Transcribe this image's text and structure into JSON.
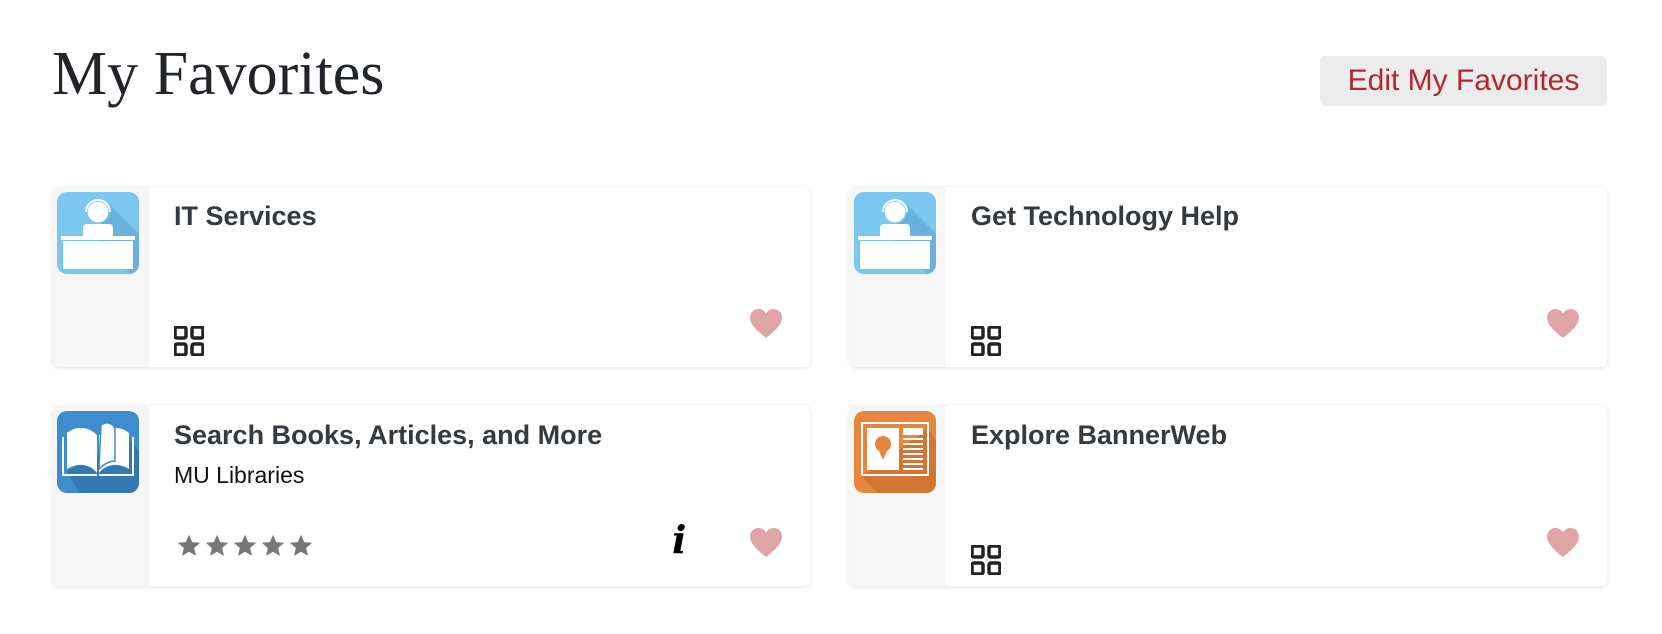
{
  "header": {
    "title": "My Favorites",
    "edit_button_label": "Edit My Favorites"
  },
  "colors": {
    "accent": "#b5272f",
    "heart": "#e0a3a6",
    "title_text": "#343a40",
    "star": "#777777"
  },
  "favorites": [
    {
      "title": "IT Services",
      "subtitle": "",
      "icon": "helpdesk-icon",
      "icon_color": "#7cc7ef",
      "footer": "grid-icon",
      "favorited": true
    },
    {
      "title": "Get Technology Help",
      "subtitle": "",
      "icon": "helpdesk-icon",
      "icon_color": "#7cc7ef",
      "footer": "grid-icon",
      "favorited": true
    },
    {
      "title": "Search Books, Articles, and More",
      "subtitle": "MU Libraries",
      "icon": "open-book-icon",
      "icon_color": "#3d8ccc",
      "footer": "rating",
      "rating": 5,
      "rating_max": 5,
      "info_label": "i",
      "favorited": true
    },
    {
      "title": "Explore BannerWeb",
      "subtitle": "",
      "icon": "profile-card-icon",
      "icon_color": "#e8853f",
      "footer": "grid-icon",
      "favorited": true
    }
  ]
}
